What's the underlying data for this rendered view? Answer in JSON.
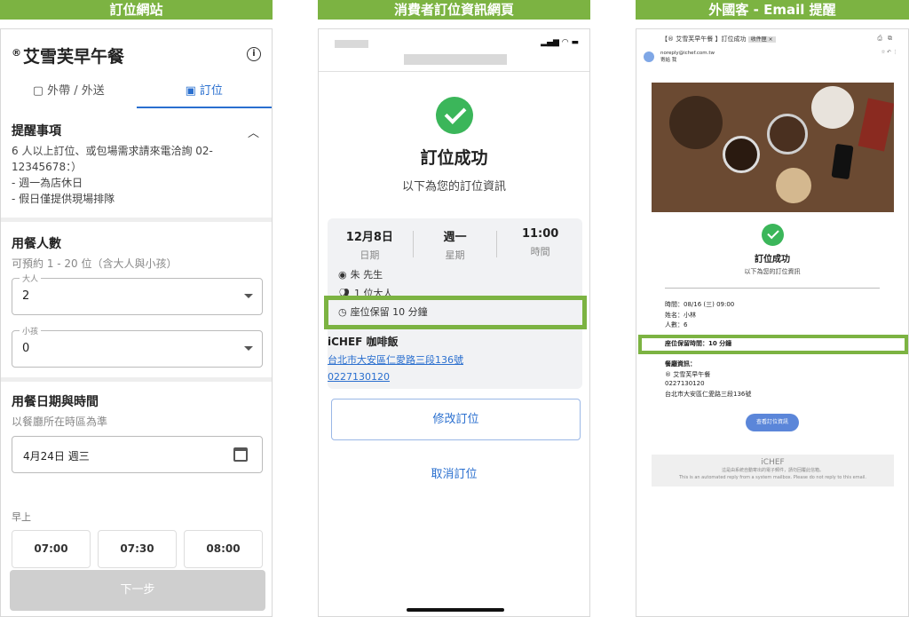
{
  "headers": {
    "website": "訂位網站",
    "consumer": "消費者訂位資訊網頁",
    "foreign": "外國客 - Email 提醒"
  },
  "website": {
    "reg_mark": "®",
    "restaurant": "艾雪芙早午餐",
    "info_icon": "i",
    "tabs": [
      "外帶 / 外送",
      "訂位"
    ],
    "notice_title": "提醒事項",
    "notice_body": "6 人以上訂位、或包場需求請來電洽詢 02-\n12345678：）\n- 週一為店休日\n- 假日僅提供現場排隊",
    "party_title": "用餐人數",
    "party_sub": "可預約 1 - 20 位（含大人與小孩）",
    "adult_label": "大人",
    "adult_value": "2",
    "child_label": "小孩",
    "child_value": "0",
    "date_title": "用餐日期與時間",
    "date_sub": "以餐廳所在時區為準",
    "date_value": "4月24日 週三",
    "period": "早上",
    "times": [
      "07:00",
      "07:30",
      "08:00"
    ],
    "next": "下一步"
  },
  "consumer": {
    "title": "訂位成功",
    "subtitle": "以下為您的訂位資訊",
    "date": "12月8日",
    "date_label": "日期",
    "weekday": "週一",
    "weekday_label": "星期",
    "time": "11:00",
    "time_label": "時間",
    "guest": "朱 先生",
    "party": "1 位大人",
    "hold": "座位保留 10 分鐘",
    "shop": "iCHEF 咖啡飯",
    "address": "台北市大安區仁愛路三段136號",
    "phone": "0227130120",
    "modify": "修改訂位",
    "cancel": "取消訂位"
  },
  "email": {
    "subject": "【® 艾雪芙早午餐 】訂位成功",
    "tag": "收件匣 ×",
    "from": "noreply@ichef.com.tw",
    "to": "寄給 我",
    "title": "訂位成功",
    "subtitle": "以下為您的訂位資訊",
    "time_line": "時間：08/16 (三) 09:00",
    "name_line": "姓名：小林",
    "people_line": "人數：6",
    "hold_line": "座位保留時間：10 分鐘",
    "rest_label": "餐廳資訊：",
    "rest_name": "® 艾雪芙早午餐",
    "rest_phone": "0227130120",
    "rest_addr": "台北市大安區仁愛路三段136號",
    "button": "查看訂位資訊",
    "logo": "iCHEF",
    "footer_zh": "這是由系統自動寄出的電子郵件，請勿回覆此信箱。",
    "footer_en": "This is an automated reply from a system mailbox. Please do not reply to this email."
  }
}
